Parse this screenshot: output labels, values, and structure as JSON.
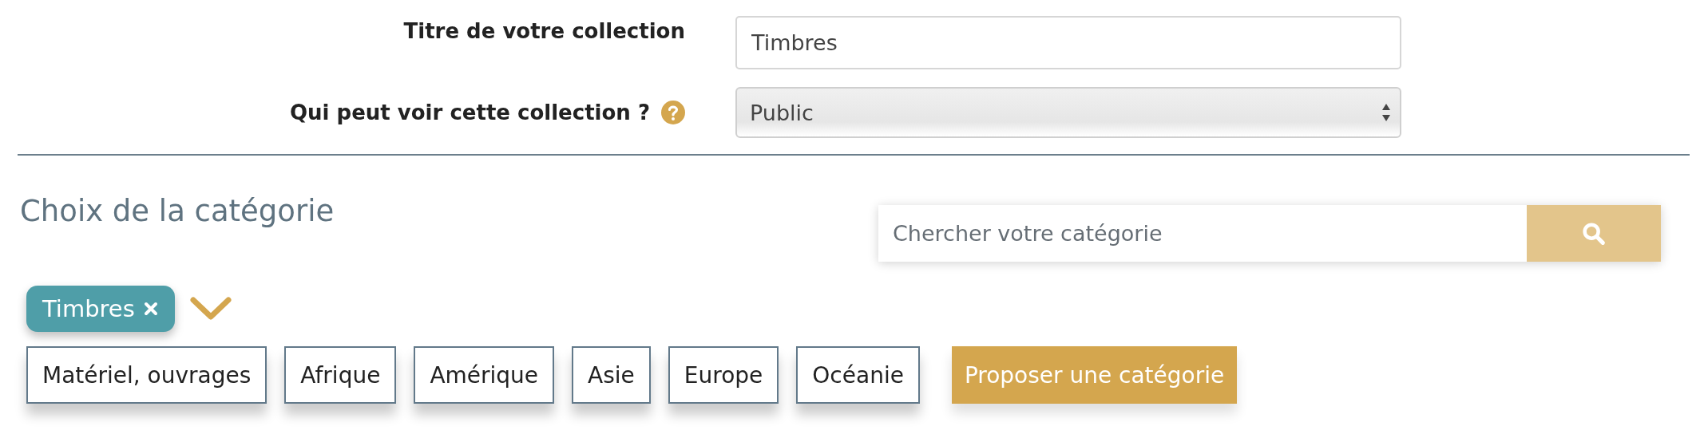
{
  "form": {
    "fields": [
      {
        "kind": "text",
        "label": "Titre de votre collection",
        "value": "Timbres",
        "help": false
      },
      {
        "kind": "select",
        "label": "Qui peut voir cette collection ?",
        "value": "Public",
        "help": true
      }
    ]
  },
  "category": {
    "title": "Choix de la catégorie",
    "search": {
      "placeholder": "Chercher votre catégorie"
    },
    "selected_tags": [
      {
        "label": "Timbres"
      }
    ],
    "subcategories": [
      {
        "label": "Matériel, ouvrages"
      },
      {
        "label": "Afrique"
      },
      {
        "label": "Amérique"
      },
      {
        "label": "Asie"
      },
      {
        "label": "Europe"
      },
      {
        "label": "Océanie"
      }
    ],
    "propose_button": "Proposer une catégorie"
  }
}
